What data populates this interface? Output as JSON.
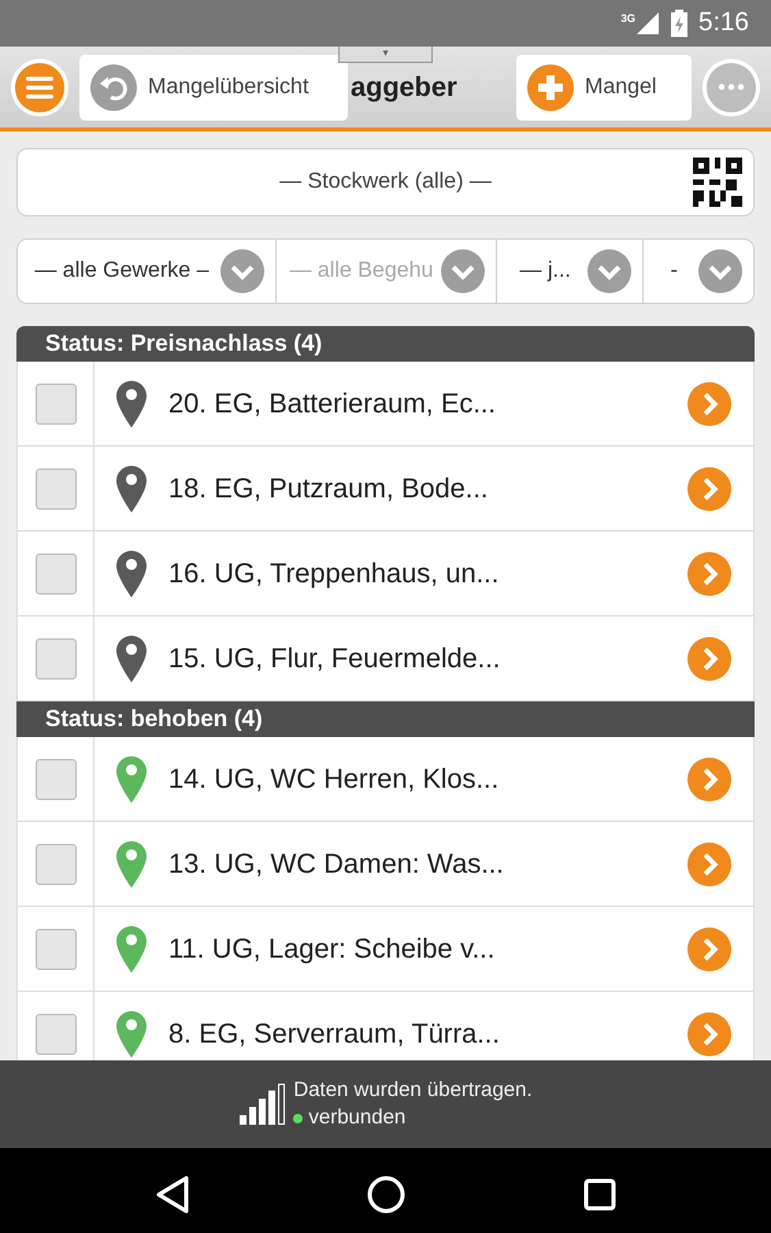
{
  "status_bar": {
    "network": "3G",
    "time": "5:16"
  },
  "app_bar": {
    "pull_handle": "▾",
    "title": "aggeber",
    "back_button": "Mangelübersicht",
    "add_button": "Mangel"
  },
  "floor_filter": {
    "value": "— Stockwerk (alle) —"
  },
  "filters": [
    {
      "value": "— alle Gewerke –",
      "disabled": false
    },
    {
      "value": "— alle Begehu",
      "disabled": true
    },
    {
      "value": "— j...",
      "disabled": false
    },
    {
      "value": "-",
      "disabled": false
    }
  ],
  "groups": [
    {
      "title": "Status: Preisnachlass (4)",
      "rows": [
        {
          "text": "20.  EG, Batterieraum, Ec...",
          "checked": false,
          "color": "#5a5a5a"
        },
        {
          "text": "18.  EG, Putzraum, Bode...",
          "checked": false,
          "color": "#5a5a5a"
        },
        {
          "text": "16.  UG, Treppenhaus, un...",
          "checked": false,
          "color": "#5a5a5a"
        },
        {
          "text": "15.  UG, Flur, Feuermelde...",
          "checked": false,
          "color": "#5a5a5a"
        }
      ]
    },
    {
      "title": "Status: behoben (4)",
      "rows": [
        {
          "text": "14.  UG, WC Herren, Klos...",
          "checked": false,
          "color": "#5cb85c"
        },
        {
          "text": "13.  UG, WC Damen: Was...",
          "checked": false,
          "color": "#5cb85c"
        },
        {
          "text": "11.  UG, Lager: Scheibe v...",
          "checked": false,
          "color": "#5cb85c"
        },
        {
          "text": "8.  EG, Serverraum, Türra...",
          "checked": false,
          "color": "#5cb85c"
        }
      ]
    }
  ],
  "sync_bar": {
    "message": "Daten wurden übertragen.",
    "connection": "verbunden",
    "connected": true
  }
}
